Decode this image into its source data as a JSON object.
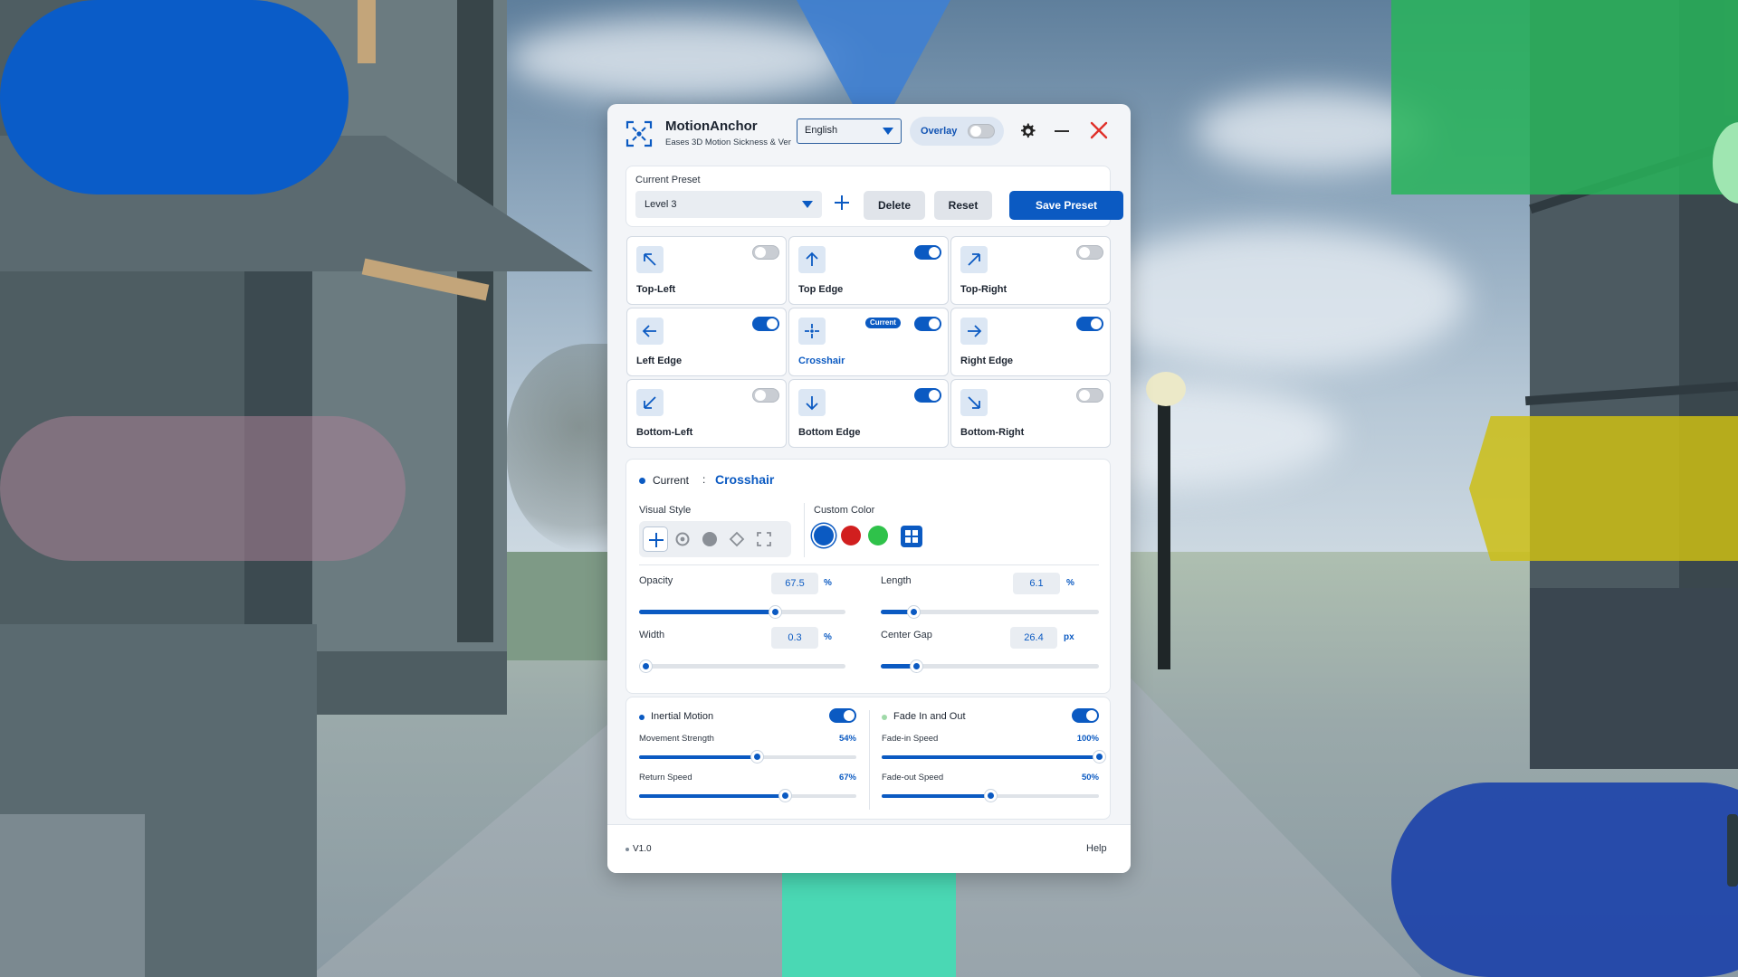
{
  "app": {
    "name": "MotionAnchor",
    "subtitle": "Eases 3D Motion Sickness & Ver",
    "language": "English",
    "overlay_label": "Overlay",
    "overlay_on": false
  },
  "preset": {
    "title": "Current Preset",
    "selected": "Level 3",
    "delete_label": "Delete",
    "reset_label": "Reset",
    "save_label": "Save Preset"
  },
  "positions": [
    {
      "label": "Top-Left",
      "icon": "arrow-up-left-icon",
      "enabled": false,
      "active": false
    },
    {
      "label": "Top Edge",
      "icon": "arrow-up-icon",
      "enabled": true,
      "active": false
    },
    {
      "label": "Top-Right",
      "icon": "arrow-up-right-icon",
      "enabled": false,
      "active": false
    },
    {
      "label": "Left Edge",
      "icon": "arrow-left-icon",
      "enabled": true,
      "active": false
    },
    {
      "label": "Crosshair",
      "icon": "crosshair-icon",
      "enabled": true,
      "active": true,
      "badge": "Current"
    },
    {
      "label": "Right Edge",
      "icon": "arrow-right-icon",
      "enabled": true,
      "active": false
    },
    {
      "label": "Bottom-Left",
      "icon": "arrow-down-left-icon",
      "enabled": false,
      "active": false
    },
    {
      "label": "Bottom Edge",
      "icon": "arrow-down-icon",
      "enabled": true,
      "active": false
    },
    {
      "label": "Bottom-Right",
      "icon": "arrow-down-right-icon",
      "enabled": false,
      "active": false
    }
  ],
  "detail": {
    "current_label": "Current",
    "colon": ":",
    "current_value": "Crosshair",
    "visual_style_label": "Visual Style",
    "visual_styles": [
      "crosshair-plus-icon",
      "ring-icon",
      "dot-icon",
      "diamond-icon",
      "corner-brackets-icon"
    ],
    "custom_color_label": "Custom Color",
    "colors": [
      "#0b5ac2",
      "#d11f1f",
      "#2fc24a"
    ],
    "sliders": {
      "opacity": {
        "label": "Opacity",
        "value": "67.5",
        "unit": "%",
        "fraction": 0.66
      },
      "length": {
        "label": "Length",
        "value": "6.1",
        "unit": "%",
        "fraction": 0.15
      },
      "width": {
        "label": "Width",
        "value": "0.3",
        "unit": "%",
        "fraction": 0.03
      },
      "center_gap": {
        "label": "Center Gap",
        "value": "26.4",
        "unit": "px",
        "fraction": 0.16
      }
    }
  },
  "motion": {
    "inertial": {
      "title": "Inertial Motion",
      "enabled": true,
      "sliders": [
        {
          "label": "Movement Strength",
          "value": "54%",
          "fraction": 0.54
        },
        {
          "label": "Return Speed",
          "value": "67%",
          "fraction": 0.67
        }
      ]
    },
    "fade": {
      "title": "Fade In and Out",
      "enabled": true,
      "sliders": [
        {
          "label": "Fade-in Speed",
          "value": "100%",
          "fraction": 1.0
        },
        {
          "label": "Fade-out Speed",
          "value": "50%",
          "fraction": 0.5
        }
      ]
    }
  },
  "footer": {
    "version": "V1.0",
    "help_label": "Help"
  }
}
